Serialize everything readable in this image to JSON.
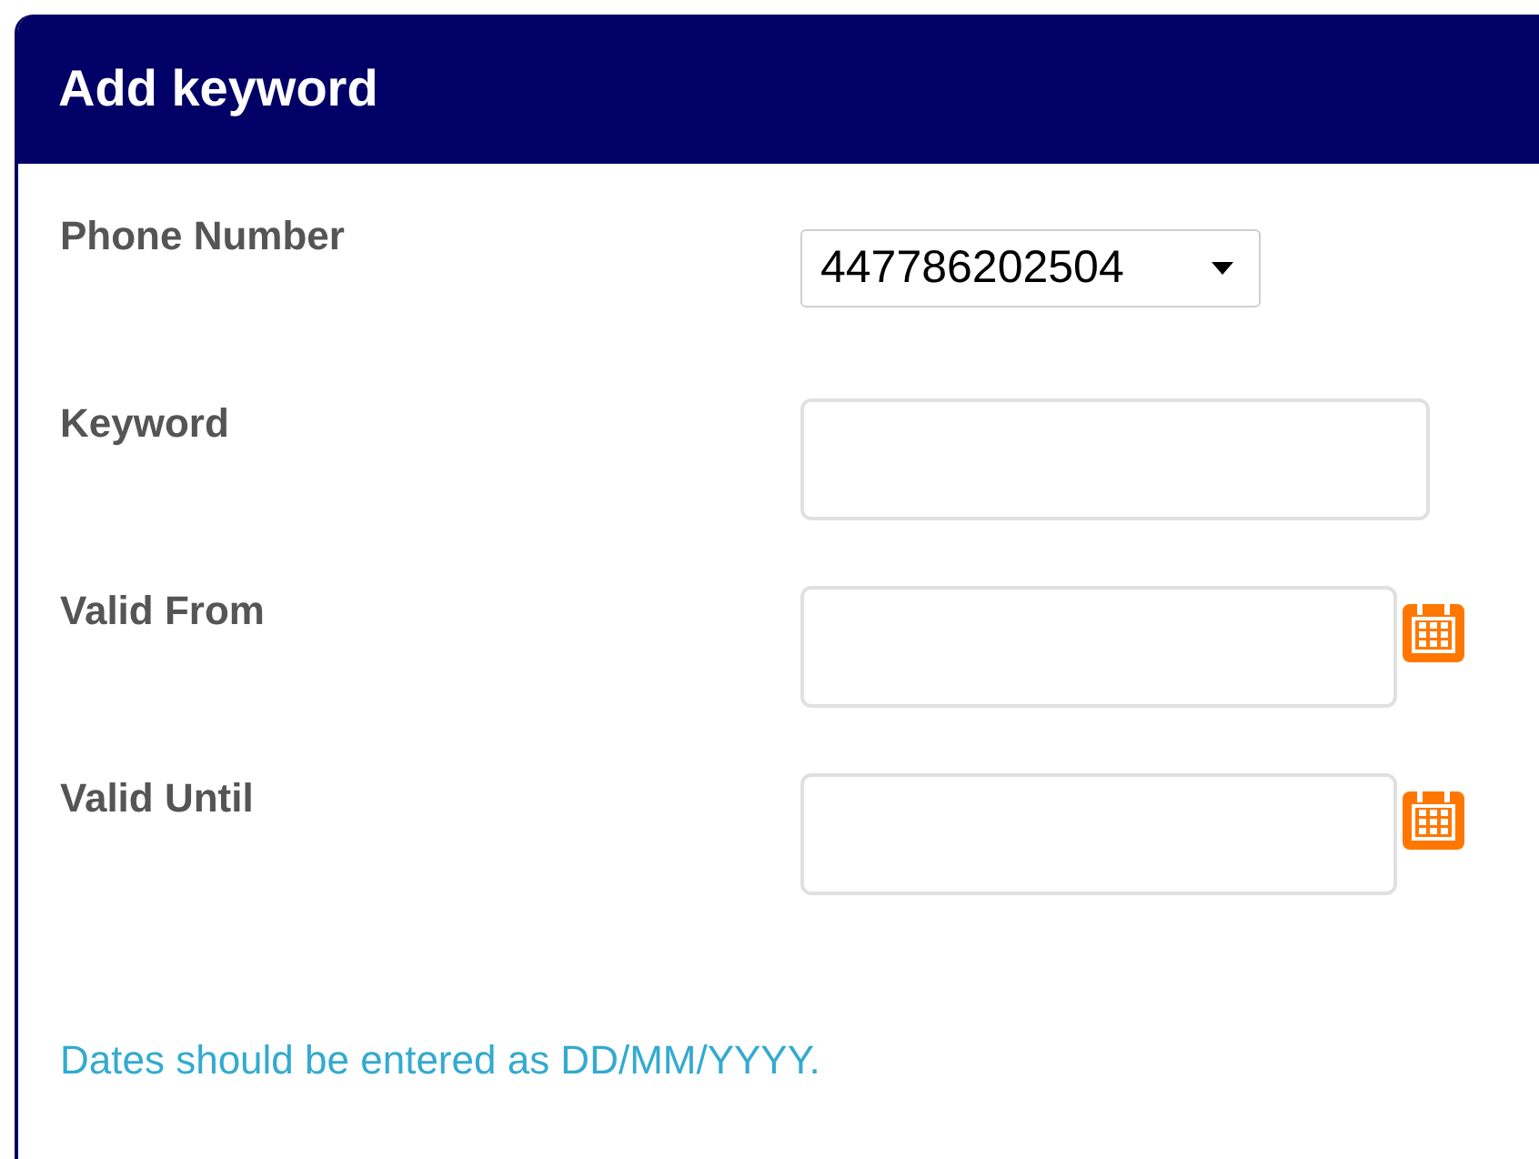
{
  "dialog": {
    "title": "Add keyword"
  },
  "fields": [
    {
      "kind": "select",
      "label": "Phone Number",
      "value": "447786202504"
    },
    {
      "kind": "text",
      "label": "Keyword"
    },
    {
      "kind": "date",
      "label": "Valid From"
    },
    {
      "kind": "date",
      "label": "Valid Until"
    }
  ],
  "note": "Dates should be entered as DD/MM/YYYY."
}
